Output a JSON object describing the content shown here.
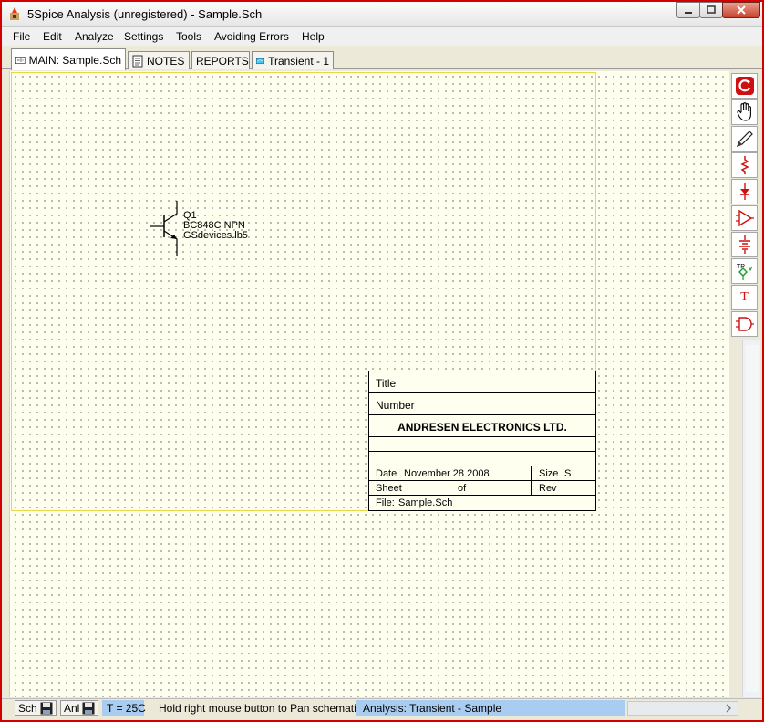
{
  "window": {
    "title": "5Spice Analysis (unregistered) - Sample.Sch"
  },
  "menu": {
    "items": [
      "File",
      "Edit",
      "Analyze",
      "Settings",
      "Tools",
      "Avoiding Errors",
      "Help"
    ]
  },
  "tabs": [
    {
      "label": "MAIN:  Sample.Sch",
      "icon": "schematic-icon",
      "active": true
    },
    {
      "label": "NOTES",
      "icon": "notes-icon",
      "active": false
    },
    {
      "label": "REPORTS",
      "icon": "",
      "active": false
    },
    {
      "label": "Transient - 1",
      "icon": "transient-plot-icon",
      "active": false
    }
  ],
  "schematic": {
    "component": {
      "ref": "Q1",
      "part": "BC848C  NPN",
      "library": "GSdevices.lb5"
    },
    "title_block": {
      "title_label": "Title",
      "number_label": "Number",
      "company": "ANDRESEN ELECTRONICS LTD.",
      "date_label": "Date",
      "date_value": "November 28 2008",
      "size_label": "Size",
      "size_value": "S",
      "sheet_label": "Sheet",
      "of_label": "of",
      "rev_label": "Rev",
      "file_label": "File:",
      "file_value": "Sample.Sch"
    }
  },
  "toolbar_right": {
    "tools": [
      "redraw-icon",
      "pan-hand-icon",
      "pencil-wire-icon",
      "resistor-icon",
      "diode-icon",
      "opamp-icon",
      "ground-battery-icon",
      "testpoint-icon",
      "text-tool-icon",
      "logic-gate-icon"
    ],
    "testpoint_label": "TP",
    "text_tool_label": "T",
    "accent_color": "#d01010"
  },
  "statusbar": {
    "sch_label": "Sch",
    "anl_label": "Anl",
    "temperature": "T = 25C",
    "hint": "Hold right mouse button to Pan schematic",
    "analysis": "Analysis:  Transient - Sample"
  }
}
